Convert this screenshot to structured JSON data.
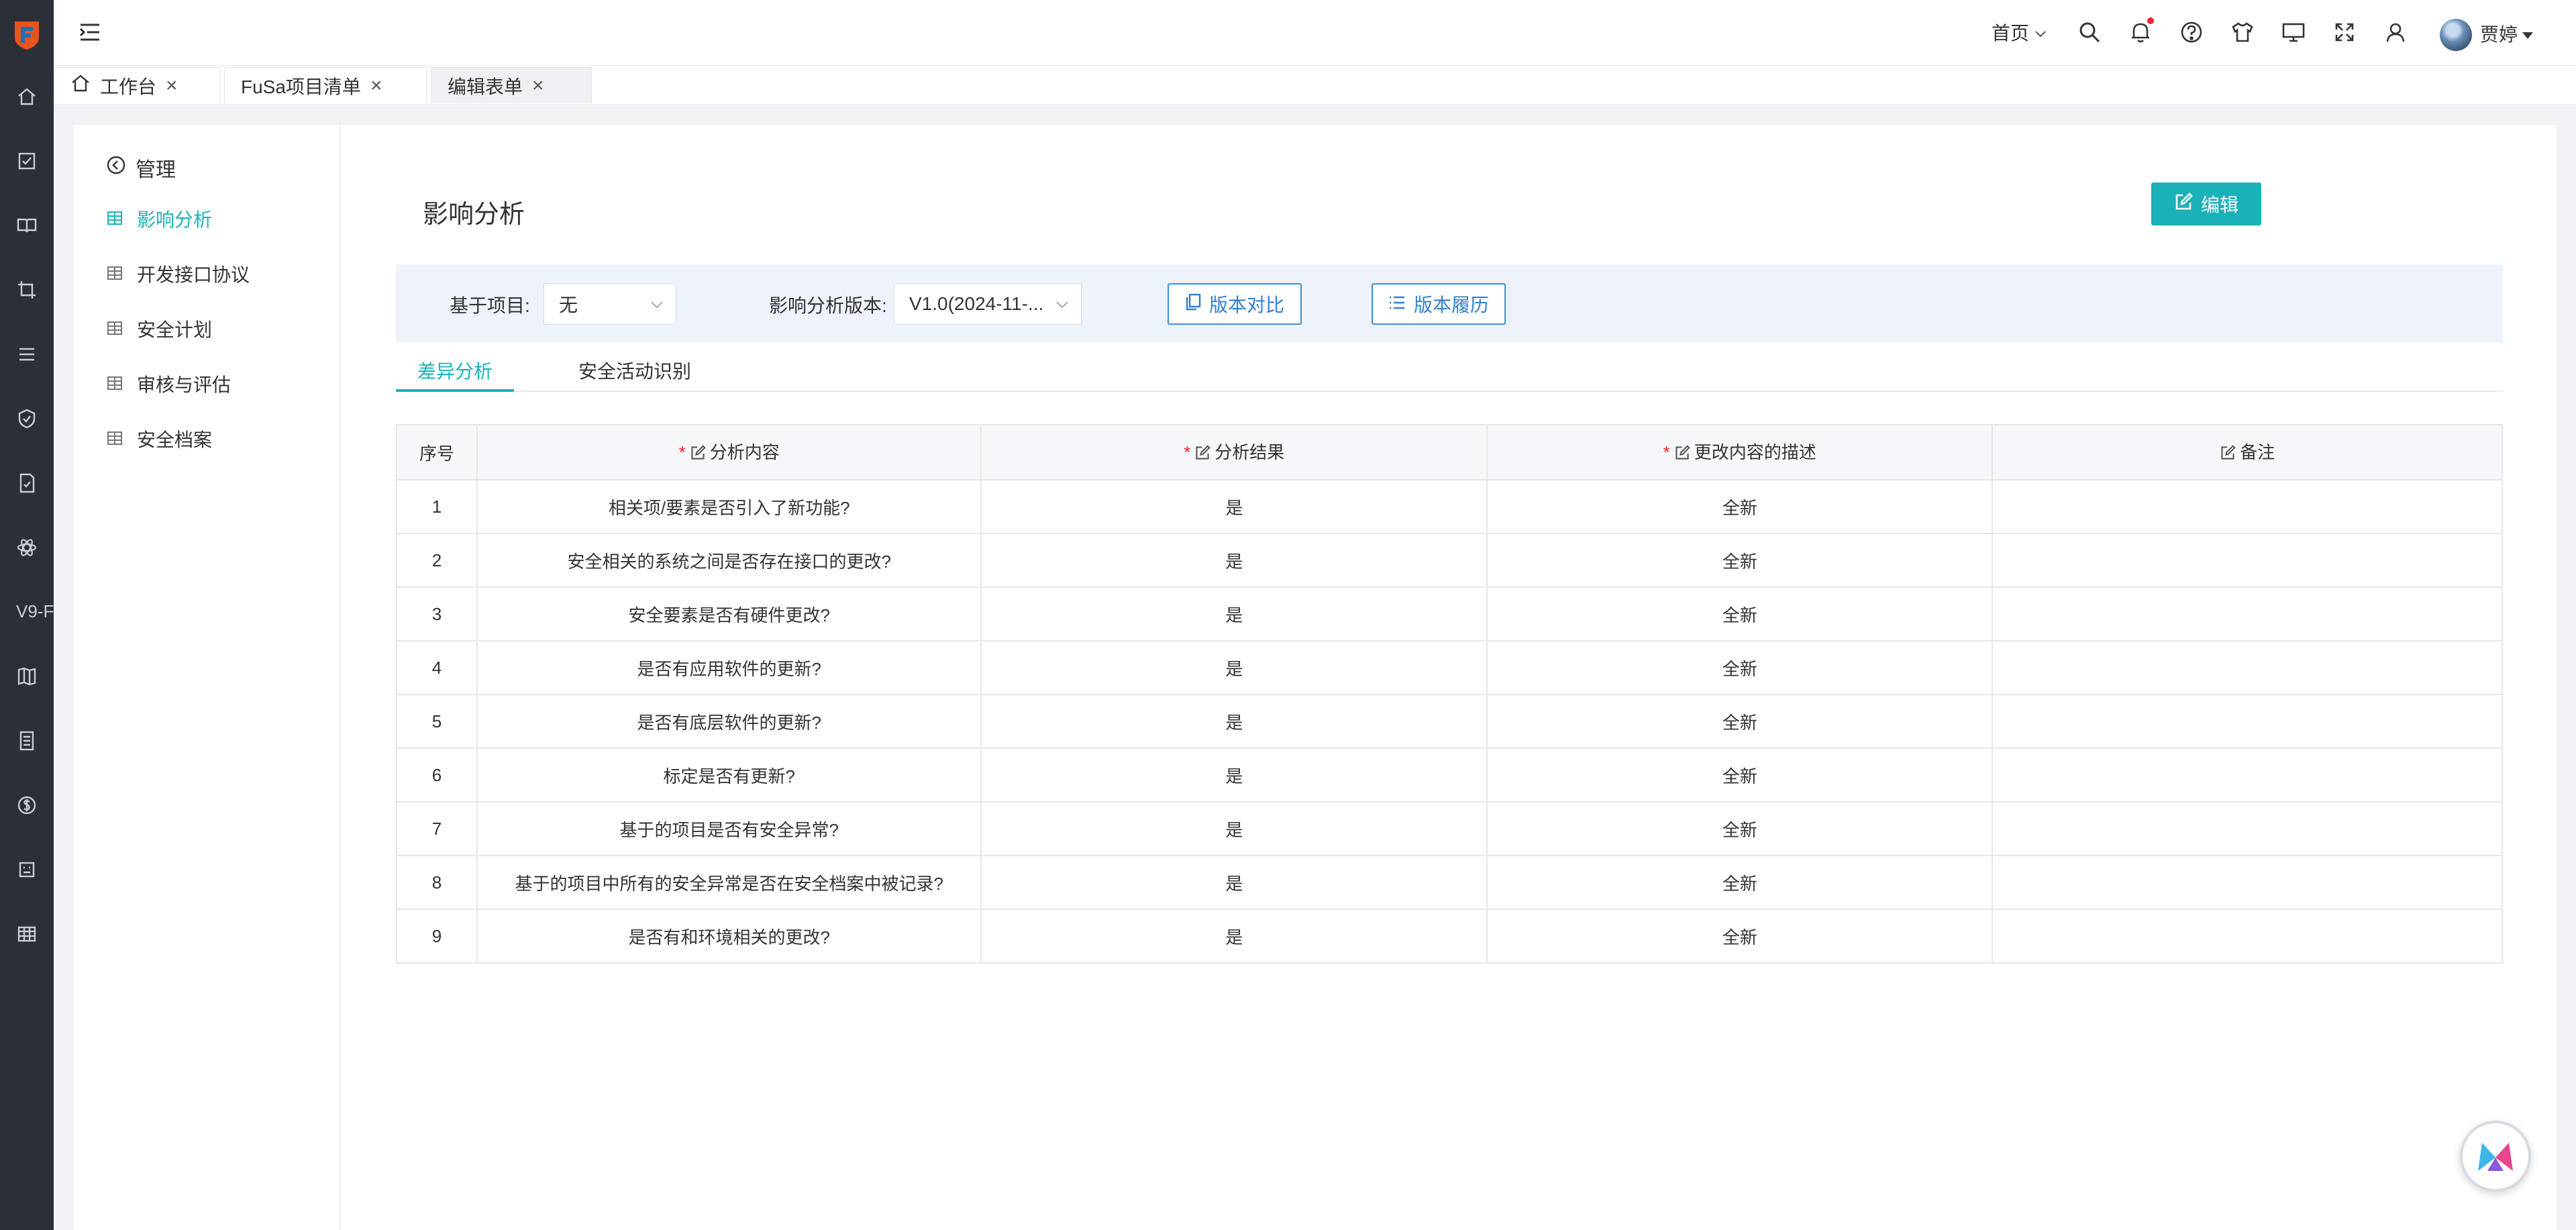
{
  "topbar": {
    "home_label": "首页",
    "user_name": "贾婷",
    "icons": [
      "search-icon",
      "bell-icon",
      "help-icon",
      "shirt-icon",
      "monitor-icon",
      "fullscreen-icon",
      "user-switch-icon"
    ]
  },
  "leftbar": {
    "text_item": "V9-F"
  },
  "tabs": [
    {
      "label": "工作台"
    },
    {
      "label": "FuSa项目清单"
    },
    {
      "label": "编辑表单"
    }
  ],
  "sidenav": {
    "back_label": "管理",
    "items": [
      {
        "label": "影响分析"
      },
      {
        "label": "开发接口协议"
      },
      {
        "label": "安全计划"
      },
      {
        "label": "审核与评估"
      },
      {
        "label": "安全档案"
      }
    ]
  },
  "page": {
    "title": "影响分析",
    "edit_label": "编辑"
  },
  "filters": {
    "project_label": "基于项目:",
    "project_value": "无",
    "version_label": "影响分析版本:",
    "version_value": "V1.0(2024-11-...",
    "compare_label": "版本对比",
    "history_label": "版本履历"
  },
  "subtabs": [
    {
      "label": "差异分析"
    },
    {
      "label": "安全活动识别"
    }
  ],
  "table": {
    "headers": [
      "序号",
      "分析内容",
      "分析结果",
      "更改内容的描述",
      "备注"
    ],
    "rows": [
      [
        "1",
        "相关项/要素是否引入了新功能?",
        "是",
        "全新",
        ""
      ],
      [
        "2",
        "安全相关的系统之间是否存在接口的更改?",
        "是",
        "全新",
        ""
      ],
      [
        "3",
        "安全要素是否有硬件更改?",
        "是",
        "全新",
        ""
      ],
      [
        "4",
        "是否有应用软件的更新?",
        "是",
        "全新",
        ""
      ],
      [
        "5",
        "是否有底层软件的更新?",
        "是",
        "全新",
        ""
      ],
      [
        "6",
        "标定是否有更新?",
        "是",
        "全新",
        ""
      ],
      [
        "7",
        "基于的项目是否有安全异常?",
        "是",
        "全新",
        ""
      ],
      [
        "8",
        "基于的项目中所有的安全异常是否在安全档案中被记录?",
        "是",
        "全新",
        ""
      ],
      [
        "9",
        "是否有和环境相关的更改?",
        "是",
        "全新",
        ""
      ]
    ]
  },
  "colors": {
    "accent": "#1ab2b8",
    "sidebar": "#2b3038",
    "outline_button": "#3a8fd9",
    "required": "#f5222d"
  }
}
